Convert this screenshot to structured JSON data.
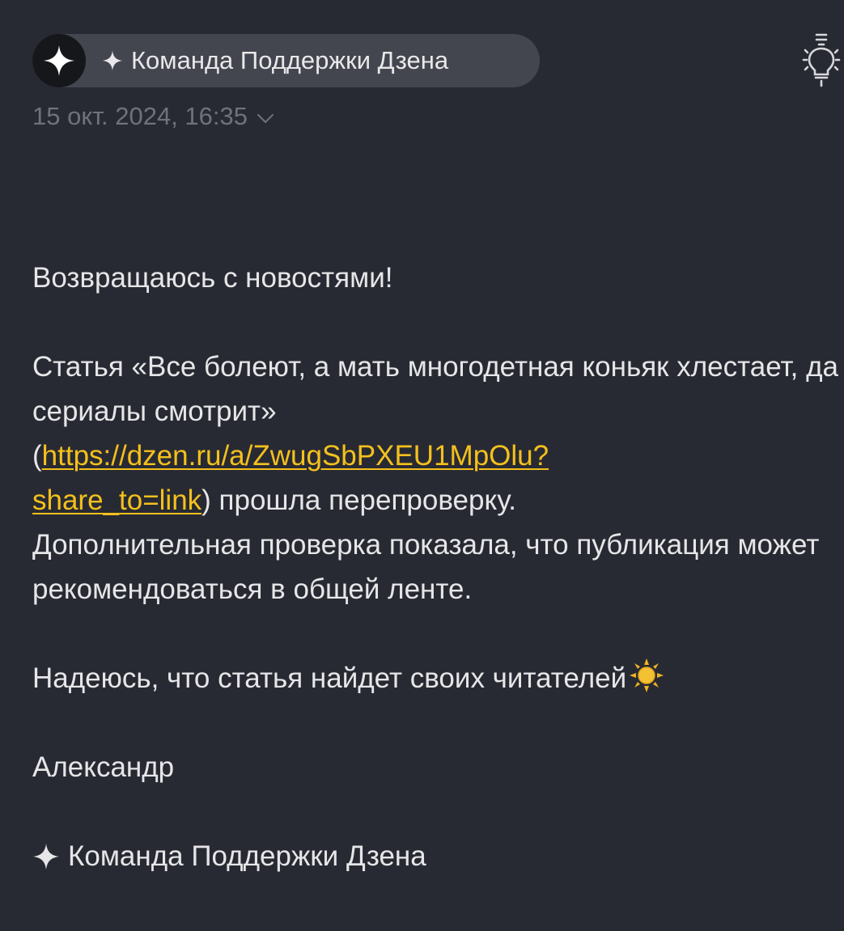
{
  "header": {
    "sender_name": "Команда Поддержки Дзена",
    "date": "15 окт. 2024, 16:35",
    "avatar_icon": "sparkle-icon",
    "right_icon": "lightbulb-icon"
  },
  "message": {
    "greeting": "Возвращаюсь с новостями!",
    "article_intro": "Статья «Все болеют, а мать многодетная коньяк хлестает, да сериалы смотрит»",
    "link_open": "(",
    "link_text": "https://dzen.ru/a/ZwugSbPXEU1MpOlu?share_to=link",
    "link_part1": "https://dzen.ru/a/ZwugSbPXEU1MpOlu?",
    "link_part2": "share_to=link",
    "link_close_rest": ") прошла перепроверку.",
    "result": "Дополнительная проверка показала, что публикация может рекомендоваться в общей ленте.",
    "wish": "Надеюсь, что статья найдет своих читателей",
    "wish_emoji": "sun-icon",
    "signature_name": "Александр",
    "signature_team": "Команда Поддержки Дзена"
  },
  "colors": {
    "background": "#282a33",
    "pill": "#43454f",
    "link": "#f4c01c",
    "text": "#e6e6e8",
    "muted": "#6f717b"
  }
}
